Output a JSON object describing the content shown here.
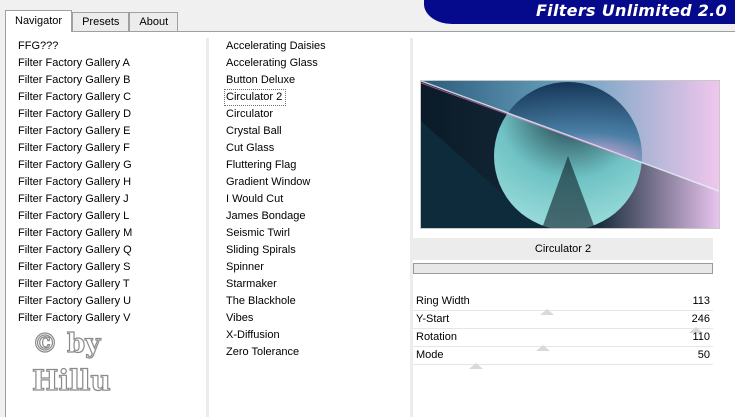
{
  "tabs": [
    {
      "label": "Navigator",
      "active": true
    },
    {
      "label": "Presets",
      "active": false
    },
    {
      "label": "About",
      "active": false
    }
  ],
  "banner": {
    "title": "Filters Unlimited 2.0",
    "color": "#050a8c"
  },
  "categories": [
    "FFG???",
    "Filter Factory Gallery A",
    "Filter Factory Gallery B",
    "Filter Factory Gallery C",
    "Filter Factory Gallery D",
    "Filter Factory Gallery E",
    "Filter Factory Gallery F",
    "Filter Factory Gallery G",
    "Filter Factory Gallery H",
    "Filter Factory Gallery J",
    "Filter Factory Gallery L",
    "Filter Factory Gallery M",
    "Filter Factory Gallery Q",
    "Filter Factory Gallery S",
    "Filter Factory Gallery T",
    "Filter Factory Gallery U",
    "Filter Factory Gallery V"
  ],
  "filters": [
    "Accelerating Daisies",
    "Accelerating Glass",
    "Button Deluxe",
    "Circulator 2",
    "Circulator",
    "Crystal Ball",
    "Cut Glass",
    "Fluttering Flag",
    "Gradient Window",
    "I Would Cut",
    "James Bondage",
    "Seismic Twirl",
    "Sliding Spirals",
    "Spinner",
    "Starmaker",
    "The Blackhole",
    "Vibes",
    "X-Diffusion",
    "Zero Tolerance"
  ],
  "selected_filter": "Circulator 2",
  "filter_title": "Circulator 2",
  "params": [
    {
      "label": "Ring Width",
      "value": "113",
      "fraction": 0.443
    },
    {
      "label": "Y-Start",
      "value": "246",
      "fraction": 0.965
    },
    {
      "label": "Rotation",
      "value": "110",
      "fraction": 0.431
    },
    {
      "label": "Mode",
      "value": "50",
      "fraction": 0.196
    }
  ],
  "watermark": {
    "line1": "© by",
    "line2": "Hillu"
  }
}
